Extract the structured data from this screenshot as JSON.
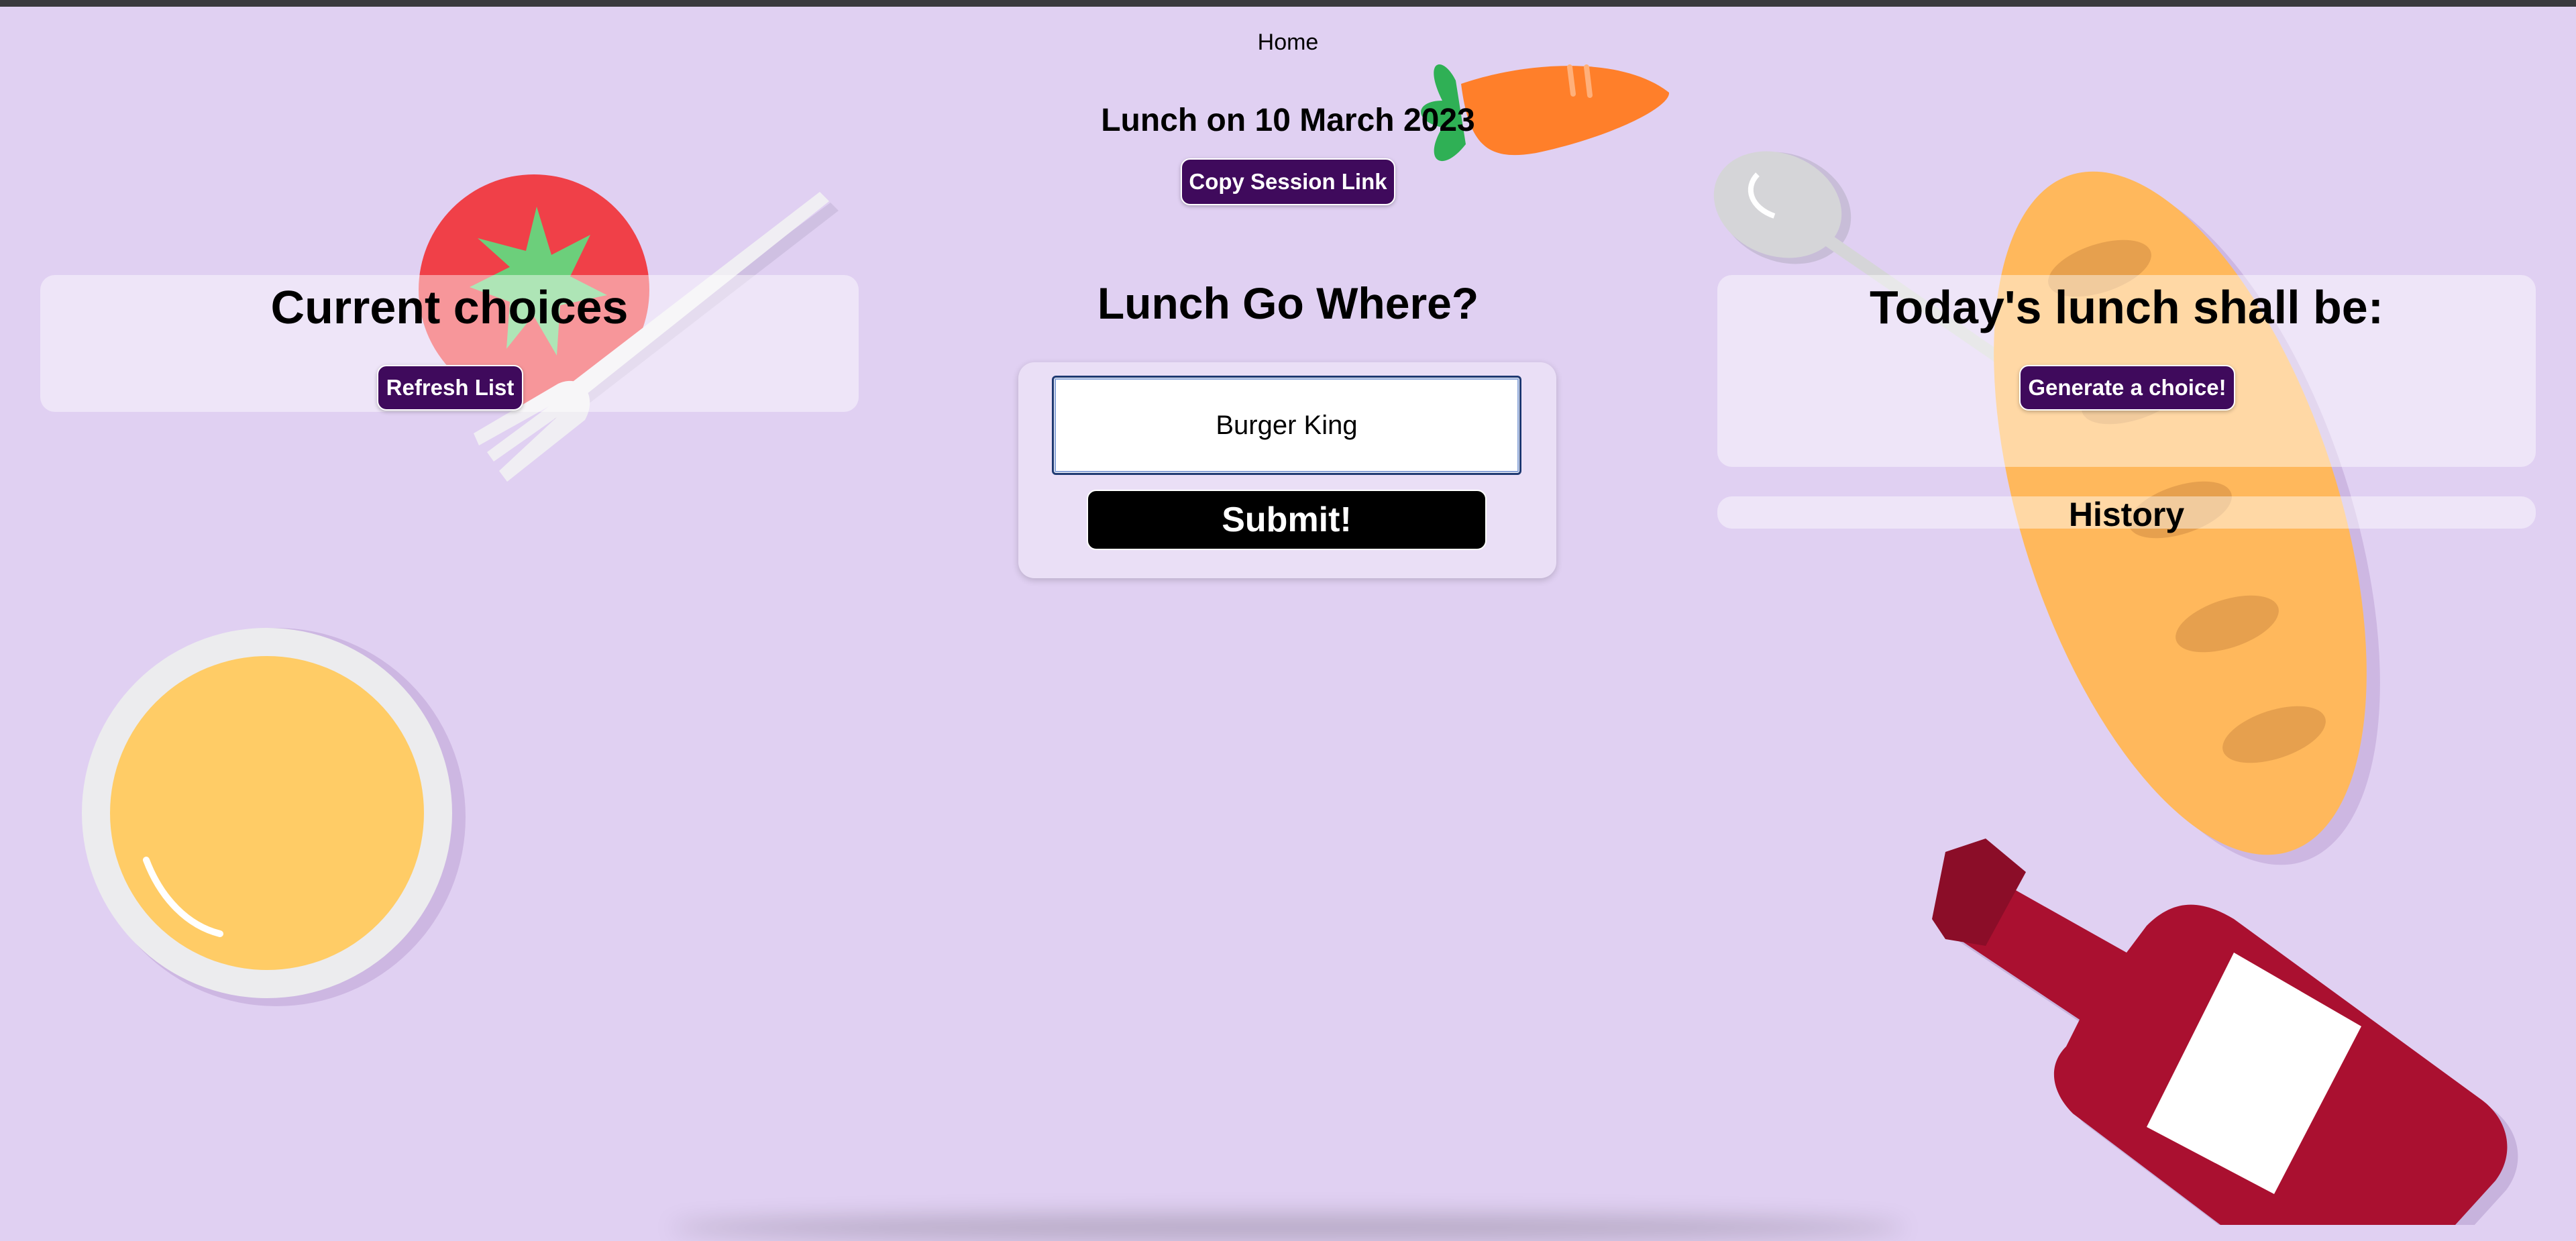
{
  "nav": {
    "home_label": "Home"
  },
  "session": {
    "title": "Lunch on 10 March 2023",
    "copy_link_label": "Copy Session Link"
  },
  "choices_panel": {
    "title": "Current choices",
    "refresh_label": "Refresh List"
  },
  "form": {
    "heading": "Lunch Go Where?",
    "input_value": "Burger King",
    "submit_label": "Submit!"
  },
  "result_panel": {
    "title": "Today's lunch shall be:",
    "generate_label": "Generate a choice!"
  },
  "history_panel": {
    "title": "History"
  },
  "decorations": [
    "tomato-icon",
    "fork-icon",
    "carrot-icon",
    "spoon-icon",
    "baguette-icon",
    "soup-bowl-icon",
    "wine-bottle-icon"
  ],
  "colors": {
    "background": "#e0d0f2",
    "button_purple": "#3f0a5c",
    "submit_black": "#000000",
    "tomato": "#f04048",
    "carrot": "#ff7f2a",
    "baguette": "#ffb85c",
    "bowl_soup": "#ffcc66",
    "wine": "#aa1030"
  }
}
